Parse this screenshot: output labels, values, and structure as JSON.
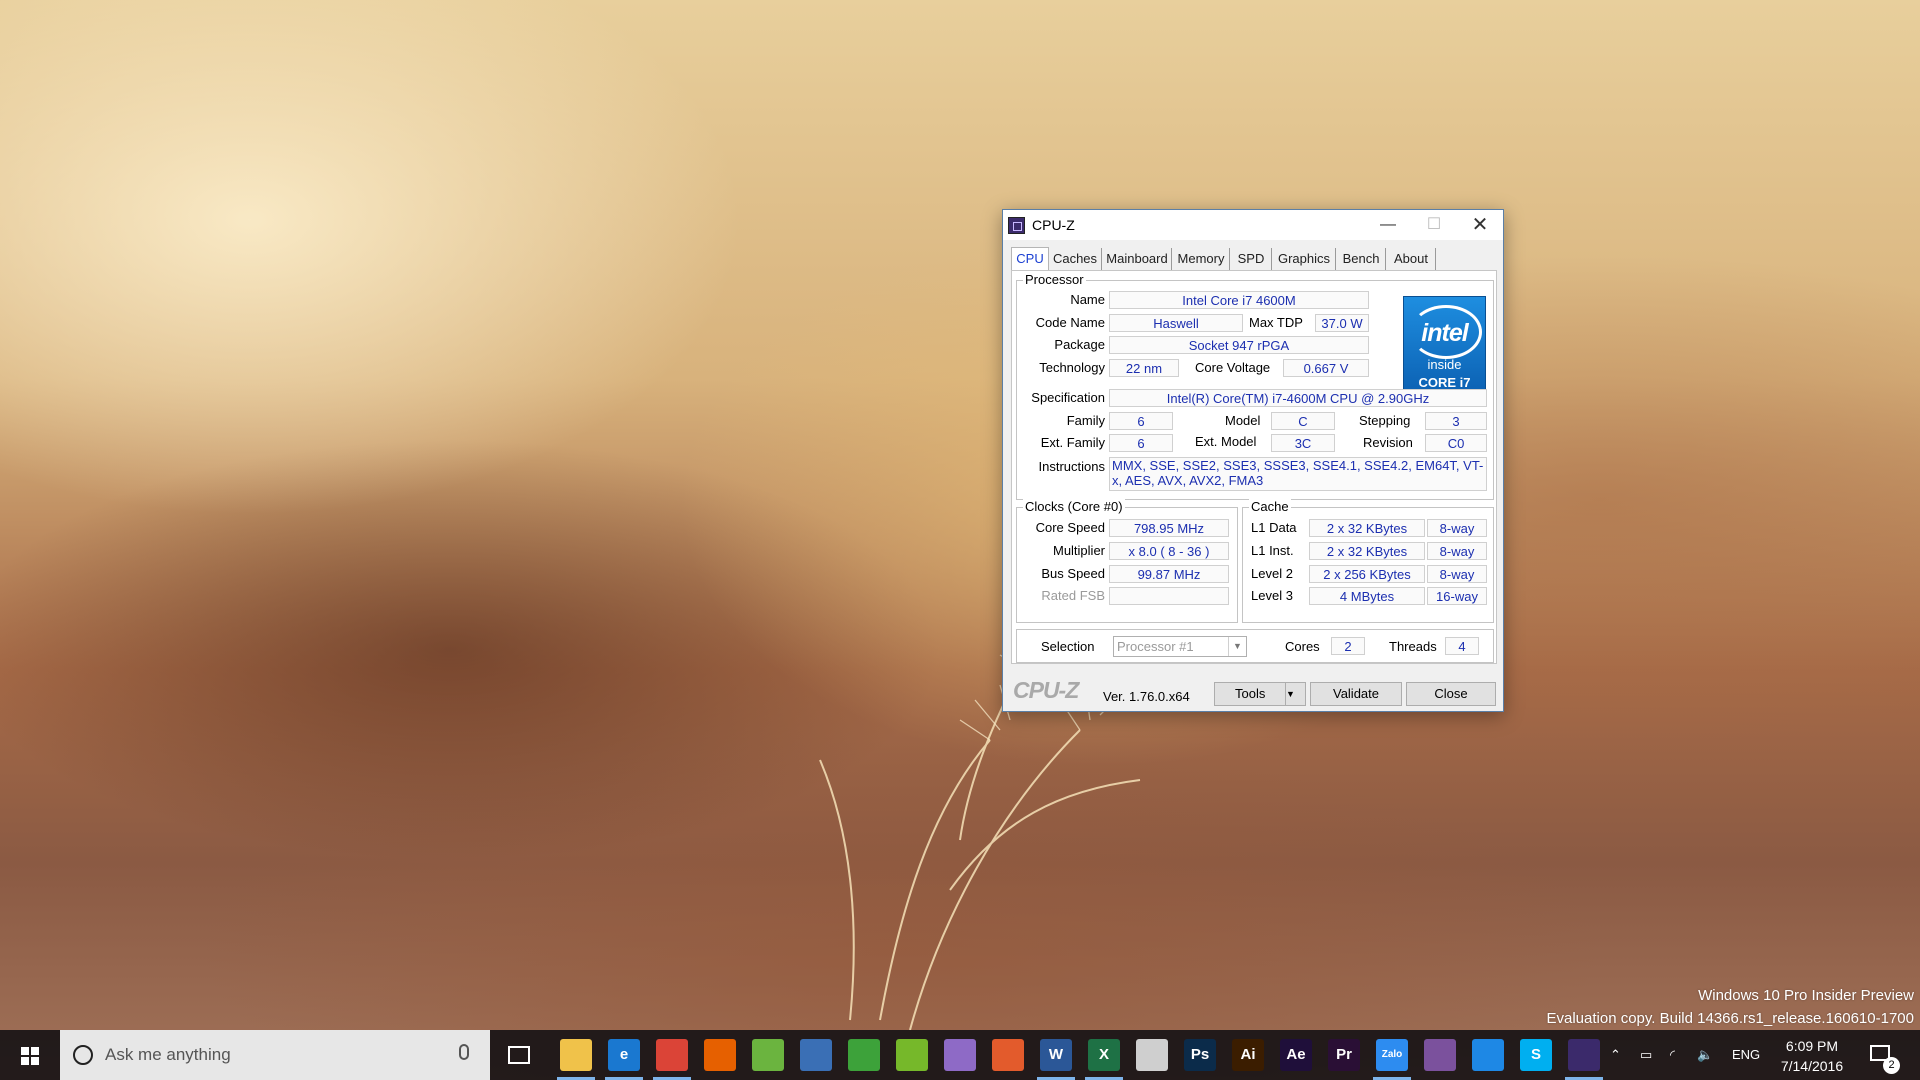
{
  "desktop": {
    "watermark_line1": "Windows 10 Pro Insider Preview",
    "watermark_line2": "Evaluation copy. Build 14366.rs1_release.160610-1700"
  },
  "window": {
    "title": "CPU-Z",
    "min_glyph": "—",
    "max_glyph": "☐",
    "close_glyph": "✕",
    "tabs": [
      "CPU",
      "Caches",
      "Mainboard",
      "Memory",
      "SPD",
      "Graphics",
      "Bench",
      "About"
    ],
    "active_tab": "CPU"
  },
  "processor": {
    "legend": "Processor",
    "name_label": "Name",
    "name": "Intel Core i7 4600M",
    "codename_label": "Code Name",
    "codename": "Haswell",
    "maxtdp_label": "Max TDP",
    "maxtdp": "37.0 W",
    "package_label": "Package",
    "package": "Socket 947 rPGA",
    "technology_label": "Technology",
    "technology": "22 nm",
    "corevoltage_label": "Core Voltage",
    "corevoltage": "0.667 V",
    "spec_label": "Specification",
    "spec": "Intel(R) Core(TM) i7-4600M CPU @ 2.90GHz",
    "family_label": "Family",
    "family": "6",
    "model_label": "Model",
    "model": "C",
    "stepping_label": "Stepping",
    "stepping": "3",
    "extfamily_label": "Ext. Family",
    "extfamily": "6",
    "extmodel_label": "Ext. Model",
    "extmodel": "3C",
    "revision_label": "Revision",
    "revision": "C0",
    "instructions_label": "Instructions",
    "instructions": "MMX, SSE, SSE2, SSE3, SSSE3, SSE4.1, SSE4.2, EM64T, VT-x, AES, AVX, AVX2, FMA3",
    "logo": {
      "brand": "intel",
      "inside": "inside",
      "line": "CORE i7",
      "colors": [
        "#1e8ee0",
        "#0b5fb1"
      ]
    }
  },
  "clocks": {
    "legend": "Clocks (Core #0)",
    "corespeed_label": "Core Speed",
    "corespeed": "798.95 MHz",
    "multiplier_label": "Multiplier",
    "multiplier": "x 8.0 ( 8 - 36 )",
    "busspeed_label": "Bus Speed",
    "busspeed": "99.87 MHz",
    "ratedfsb_label": "Rated FSB",
    "ratedfsb": ""
  },
  "cache": {
    "legend": "Cache",
    "rows": [
      {
        "label": "L1 Data",
        "size": "2 x 32 KBytes",
        "ways": "8-way"
      },
      {
        "label": "L1 Inst.",
        "size": "2 x 32 KBytes",
        "ways": "8-way"
      },
      {
        "label": "Level 2",
        "size": "2 x 256 KBytes",
        "ways": "8-way"
      },
      {
        "label": "Level 3",
        "size": "4 MBytes",
        "ways": "16-way"
      }
    ]
  },
  "selection": {
    "label": "Selection",
    "value": "Processor #1",
    "cores_label": "Cores",
    "cores": "2",
    "threads_label": "Threads",
    "threads": "4"
  },
  "footer": {
    "logo": "CPU-Z",
    "version": "Ver. 1.76.0.x64",
    "tools": "Tools",
    "validate": "Validate",
    "close": "Close"
  },
  "taskbar": {
    "search_placeholder": "Ask me anything",
    "apps": [
      {
        "name": "file-explorer",
        "glyph": "",
        "color": "#f0c24a",
        "running": true
      },
      {
        "name": "edge",
        "glyph": "e",
        "color": "#1a78d0",
        "running": true
      },
      {
        "name": "chrome",
        "glyph": "",
        "color": "#db4437",
        "running": true
      },
      {
        "name": "firefox",
        "glyph": "",
        "color": "#e66000",
        "running": false
      },
      {
        "name": "coccoc",
        "glyph": "",
        "color": "#6bb43f",
        "running": false
      },
      {
        "name": "ie-vpn",
        "glyph": "",
        "color": "#3a6fb5",
        "running": false
      },
      {
        "name": "browser-green",
        "glyph": "",
        "color": "#3da23a",
        "running": false
      },
      {
        "name": "utorrent",
        "glyph": "",
        "color": "#76b82a",
        "running": false
      },
      {
        "name": "visual-studio",
        "glyph": "",
        "color": "#8e6ac6",
        "running": false
      },
      {
        "name": "antivirus",
        "glyph": "",
        "color": "#e35b2c",
        "running": false
      },
      {
        "name": "word",
        "glyph": "W",
        "color": "#2b5797",
        "running": true
      },
      {
        "name": "excel",
        "glyph": "X",
        "color": "#1e7145",
        "running": true
      },
      {
        "name": "usb-drive",
        "glyph": "",
        "color": "#cfcfcf",
        "running": false
      },
      {
        "name": "photoshop",
        "glyph": "Ps",
        "color": "#0b2b4a",
        "running": false
      },
      {
        "name": "illustrator",
        "glyph": "Ai",
        "color": "#3b1d00",
        "running": false
      },
      {
        "name": "after-effects",
        "glyph": "Ae",
        "color": "#1f0f3a",
        "running": false
      },
      {
        "name": "premiere",
        "glyph": "Pr",
        "color": "#2a0f35",
        "running": false
      },
      {
        "name": "zalo",
        "glyph": "Zalo",
        "color": "#2d8cf0",
        "running": true
      },
      {
        "name": "viber",
        "glyph": "",
        "color": "#7b519d",
        "running": false
      },
      {
        "name": "messenger",
        "glyph": "",
        "color": "#1e88e5",
        "running": false
      },
      {
        "name": "skype",
        "glyph": "S",
        "color": "#00aff0",
        "running": false
      },
      {
        "name": "cpu-z",
        "glyph": "",
        "color": "#3b2a6b",
        "running": true,
        "active": true
      }
    ],
    "lang": "ENG",
    "time": "6:09 PM",
    "date": "7/14/2016",
    "notification_count": "2"
  }
}
